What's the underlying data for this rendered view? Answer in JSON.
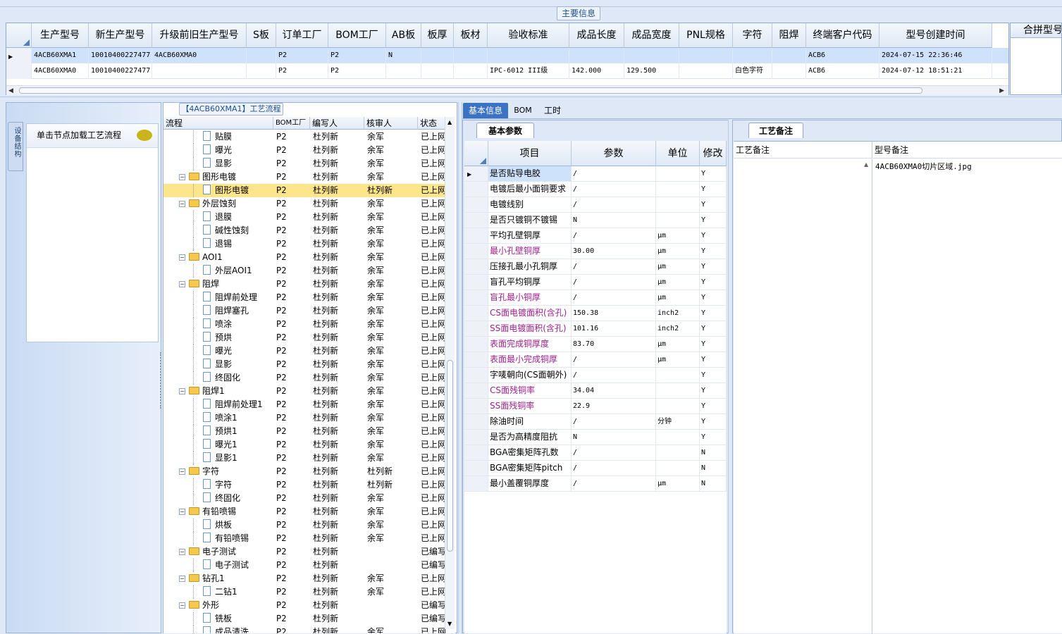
{
  "main_info": {
    "label": "主要信息",
    "columns": [
      "生产型号",
      "新生产型号",
      "升级前旧生产型号",
      "S板",
      "订单工厂",
      "BOM工厂",
      "AB板",
      "板厚",
      "板材",
      "验收标准",
      "成品长度",
      "成品宽度",
      "PNL规格",
      "字符",
      "阻焊",
      "终端客户代码",
      "型号创建时间"
    ],
    "rows": [
      {
        "selected": true,
        "cells": [
          "4ACB60XMA1",
          "10010400227477",
          "4ACB60XMA0",
          "",
          "P2",
          "P2",
          "N",
          "",
          "",
          "",
          "",
          "",
          "",
          "",
          "",
          "ACB6",
          "2024-07-15 22:36:46"
        ]
      },
      {
        "selected": false,
        "cells": [
          "4ACB60XMA0",
          "10010400227477",
          "",
          "",
          "P2",
          "P2",
          "",
          "",
          "",
          "IPC-6012 III级",
          "142.000",
          "129.500",
          "",
          "白色字符",
          "",
          "ACB6",
          "2024-07-12 18:51:21"
        ]
      }
    ],
    "right_panel_title": "合拼型号"
  },
  "left_side": {
    "vertical_tab": "设备结构",
    "load_hint": "单击节点加载工艺流程"
  },
  "process_flow": {
    "title": "【4ACB60XMA1】工艺流程",
    "columns": [
      "流程",
      "BOM工厂",
      "编写人",
      "核审人",
      "状态"
    ],
    "rows": [
      {
        "level": 2,
        "type": "doc",
        "name": "贴膜",
        "bom": "P2",
        "writer": "杜列新",
        "reviewer": "余军",
        "status": "已上网"
      },
      {
        "level": 2,
        "type": "doc",
        "name": "曝光",
        "bom": "P2",
        "writer": "杜列新",
        "reviewer": "余军",
        "status": "已上网"
      },
      {
        "level": 2,
        "type": "doc",
        "name": "显影",
        "bom": "P2",
        "writer": "杜列新",
        "reviewer": "余军",
        "status": "已上网"
      },
      {
        "level": 1,
        "type": "folder",
        "name": "图形电镀",
        "bom": "P2",
        "writer": "杜列新",
        "reviewer": "余军",
        "status": "已上网"
      },
      {
        "level": 2,
        "type": "doc",
        "name": "图形电镀",
        "bom": "P2",
        "writer": "杜列新",
        "reviewer": "杜列新",
        "status": "已上网",
        "selected": true
      },
      {
        "level": 1,
        "type": "folder",
        "name": "外层蚀刻",
        "bom": "P2",
        "writer": "杜列新",
        "reviewer": "余军",
        "status": "已上网"
      },
      {
        "level": 2,
        "type": "doc",
        "name": "退膜",
        "bom": "P2",
        "writer": "杜列新",
        "reviewer": "余军",
        "status": "已上网"
      },
      {
        "level": 2,
        "type": "doc",
        "name": "碱性蚀刻",
        "bom": "P2",
        "writer": "杜列新",
        "reviewer": "余军",
        "status": "已上网"
      },
      {
        "level": 2,
        "type": "doc",
        "name": "退锡",
        "bom": "P2",
        "writer": "杜列新",
        "reviewer": "余军",
        "status": "已上网"
      },
      {
        "level": 1,
        "type": "folder",
        "name": "AOI1",
        "bom": "P2",
        "writer": "杜列新",
        "reviewer": "余军",
        "status": "已上网"
      },
      {
        "level": 2,
        "type": "doc",
        "name": "外层AOI1",
        "bom": "P2",
        "writer": "杜列新",
        "reviewer": "余军",
        "status": "已上网"
      },
      {
        "level": 1,
        "type": "folder",
        "name": "阻焊",
        "bom": "P2",
        "writer": "杜列新",
        "reviewer": "余军",
        "status": "已上网"
      },
      {
        "level": 2,
        "type": "doc",
        "name": "阻焊前处理",
        "bom": "P2",
        "writer": "杜列新",
        "reviewer": "余军",
        "status": "已上网"
      },
      {
        "level": 2,
        "type": "doc",
        "name": "阻焊塞孔",
        "bom": "P2",
        "writer": "杜列新",
        "reviewer": "余军",
        "status": "已上网"
      },
      {
        "level": 2,
        "type": "doc",
        "name": "喷涂",
        "bom": "P2",
        "writer": "杜列新",
        "reviewer": "余军",
        "status": "已上网"
      },
      {
        "level": 2,
        "type": "doc",
        "name": "预烘",
        "bom": "P2",
        "writer": "杜列新",
        "reviewer": "余军",
        "status": "已上网"
      },
      {
        "level": 2,
        "type": "doc",
        "name": "曝光",
        "bom": "P2",
        "writer": "杜列新",
        "reviewer": "余军",
        "status": "已上网"
      },
      {
        "level": 2,
        "type": "doc",
        "name": "显影",
        "bom": "P2",
        "writer": "杜列新",
        "reviewer": "余军",
        "status": "已上网"
      },
      {
        "level": 2,
        "type": "doc",
        "name": "终固化",
        "bom": "P2",
        "writer": "杜列新",
        "reviewer": "余军",
        "status": "已上网"
      },
      {
        "level": 1,
        "type": "folder",
        "name": "阻焊1",
        "bom": "P2",
        "writer": "杜列新",
        "reviewer": "余军",
        "status": "已上网"
      },
      {
        "level": 2,
        "type": "doc",
        "name": "阻焊前处理1",
        "bom": "P2",
        "writer": "杜列新",
        "reviewer": "余军",
        "status": "已上网"
      },
      {
        "level": 2,
        "type": "doc",
        "name": "喷涂1",
        "bom": "P2",
        "writer": "杜列新",
        "reviewer": "余军",
        "status": "已上网"
      },
      {
        "level": 2,
        "type": "doc",
        "name": "预烘1",
        "bom": "P2",
        "writer": "杜列新",
        "reviewer": "余军",
        "status": "已上网"
      },
      {
        "level": 2,
        "type": "doc",
        "name": "曝光1",
        "bom": "P2",
        "writer": "杜列新",
        "reviewer": "余军",
        "status": "已上网"
      },
      {
        "level": 2,
        "type": "doc",
        "name": "显影1",
        "bom": "P2",
        "writer": "杜列新",
        "reviewer": "余军",
        "status": "已上网"
      },
      {
        "level": 1,
        "type": "folder",
        "name": "字符",
        "bom": "P2",
        "writer": "杜列新",
        "reviewer": "杜列新",
        "status": "已上网"
      },
      {
        "level": 2,
        "type": "doc",
        "name": "字符",
        "bom": "P2",
        "writer": "杜列新",
        "reviewer": "杜列新",
        "status": "已上网"
      },
      {
        "level": 2,
        "type": "doc",
        "name": "终固化",
        "bom": "P2",
        "writer": "杜列新",
        "reviewer": "余军",
        "status": "已上网"
      },
      {
        "level": 1,
        "type": "folder",
        "name": "有铅喷锡",
        "bom": "P2",
        "writer": "杜列新",
        "reviewer": "余军",
        "status": "已上网"
      },
      {
        "level": 2,
        "type": "doc",
        "name": "烘板",
        "bom": "P2",
        "writer": "杜列新",
        "reviewer": "余军",
        "status": "已上网"
      },
      {
        "level": 2,
        "type": "doc",
        "name": "有铅喷锡",
        "bom": "P2",
        "writer": "杜列新",
        "reviewer": "余军",
        "status": "已上网"
      },
      {
        "level": 1,
        "type": "folder",
        "name": "电子测试",
        "bom": "P2",
        "writer": "杜列新",
        "reviewer": "",
        "status": "已编写"
      },
      {
        "level": 2,
        "type": "doc",
        "name": "电子测试",
        "bom": "P2",
        "writer": "杜列新",
        "reviewer": "",
        "status": "已编写"
      },
      {
        "level": 1,
        "type": "folder",
        "name": "钻孔1",
        "bom": "P2",
        "writer": "杜列新",
        "reviewer": "余军",
        "status": "已上网"
      },
      {
        "level": 2,
        "type": "doc",
        "name": "二钻1",
        "bom": "P2",
        "writer": "杜列新",
        "reviewer": "余军",
        "status": "已上网"
      },
      {
        "level": 1,
        "type": "folder",
        "name": "外形",
        "bom": "P2",
        "writer": "杜列新",
        "reviewer": "",
        "status": "已编写"
      },
      {
        "level": 2,
        "type": "doc",
        "name": "铣板",
        "bom": "P2",
        "writer": "杜列新",
        "reviewer": "",
        "status": "已编写"
      },
      {
        "level": 2,
        "type": "doc",
        "name": "成品清洗",
        "bom": "P2",
        "writer": "杜列新",
        "reviewer": "余军",
        "status": "已上网"
      }
    ]
  },
  "detail_tabs": [
    "基本信息",
    "BOM",
    "工时"
  ],
  "basic_params": {
    "tab": "基本参数",
    "columns": [
      "项目",
      "参数",
      "单位",
      "修改"
    ],
    "rows": [
      {
        "item": "是否贴导电胶",
        "value": "/",
        "unit": "",
        "mod": "Y",
        "highlight": false,
        "selected": true
      },
      {
        "item": "电镀后最小面铜要求",
        "value": "/",
        "unit": "",
        "mod": "Y",
        "highlight": false
      },
      {
        "item": "电镀线别",
        "value": "/",
        "unit": "",
        "mod": "Y",
        "highlight": false
      },
      {
        "item": "是否只镀铜不镀锡",
        "value": "N",
        "unit": "",
        "mod": "Y",
        "highlight": false
      },
      {
        "item": "平均孔壁铜厚",
        "value": "/",
        "unit": "μm",
        "mod": "Y",
        "highlight": false
      },
      {
        "item": "最小孔壁铜厚",
        "value": "30.00",
        "unit": "μm",
        "mod": "Y",
        "highlight": true
      },
      {
        "item": "压接孔最小孔铜厚",
        "value": "/",
        "unit": "μm",
        "mod": "Y",
        "highlight": false
      },
      {
        "item": "盲孔平均铜厚",
        "value": "/",
        "unit": "μm",
        "mod": "Y",
        "highlight": false
      },
      {
        "item": "盲孔最小铜厚",
        "value": "/",
        "unit": "μm",
        "mod": "Y",
        "highlight": true
      },
      {
        "item": "CS面电镀面积(含孔)",
        "value": "150.38",
        "unit": "inch2",
        "mod": "Y",
        "highlight": true
      },
      {
        "item": "SS面电镀面积(含孔)",
        "value": "101.16",
        "unit": "inch2",
        "mod": "Y",
        "highlight": true
      },
      {
        "item": "表面完成铜厚度",
        "value": "83.70",
        "unit": "μm",
        "mod": "Y",
        "highlight": true
      },
      {
        "item": "表面最小完成铜厚",
        "value": "/",
        "unit": "μm",
        "mod": "Y",
        "highlight": true
      },
      {
        "item": "字唛朝向(CS面朝外)",
        "value": "/",
        "unit": "",
        "mod": "Y",
        "highlight": false
      },
      {
        "item": "CS面残铜率",
        "value": "34.04",
        "unit": "",
        "mod": "Y",
        "highlight": true
      },
      {
        "item": "SS面残铜率",
        "value": "22.9",
        "unit": "",
        "mod": "Y",
        "highlight": true
      },
      {
        "item": "除油时间",
        "value": "/",
        "unit": "分钟",
        "mod": "Y",
        "highlight": false
      },
      {
        "item": "是否为高精度阻抗",
        "value": "N",
        "unit": "",
        "mod": "Y",
        "highlight": false
      },
      {
        "item": "BGA密集矩阵孔数",
        "value": "/",
        "unit": "",
        "mod": "N",
        "highlight": false
      },
      {
        "item": "BGA密集矩阵pitch",
        "value": "/",
        "unit": "",
        "mod": "N",
        "highlight": false
      },
      {
        "item": "最小盖覆铜厚度",
        "value": "/",
        "unit": "μm",
        "mod": "N",
        "highlight": false
      }
    ]
  },
  "process_notes": {
    "tab": "工艺备注",
    "col_process": "工艺备注",
    "col_model": "型号备注",
    "model_note": "4ACB60XMA0切片区域.jpg"
  },
  "colors": {
    "highlight_text": "#a0208c",
    "selected_row": "#cfe2fb",
    "selected_tree": "#fde58c",
    "header_blue": "#1f5fb8"
  }
}
